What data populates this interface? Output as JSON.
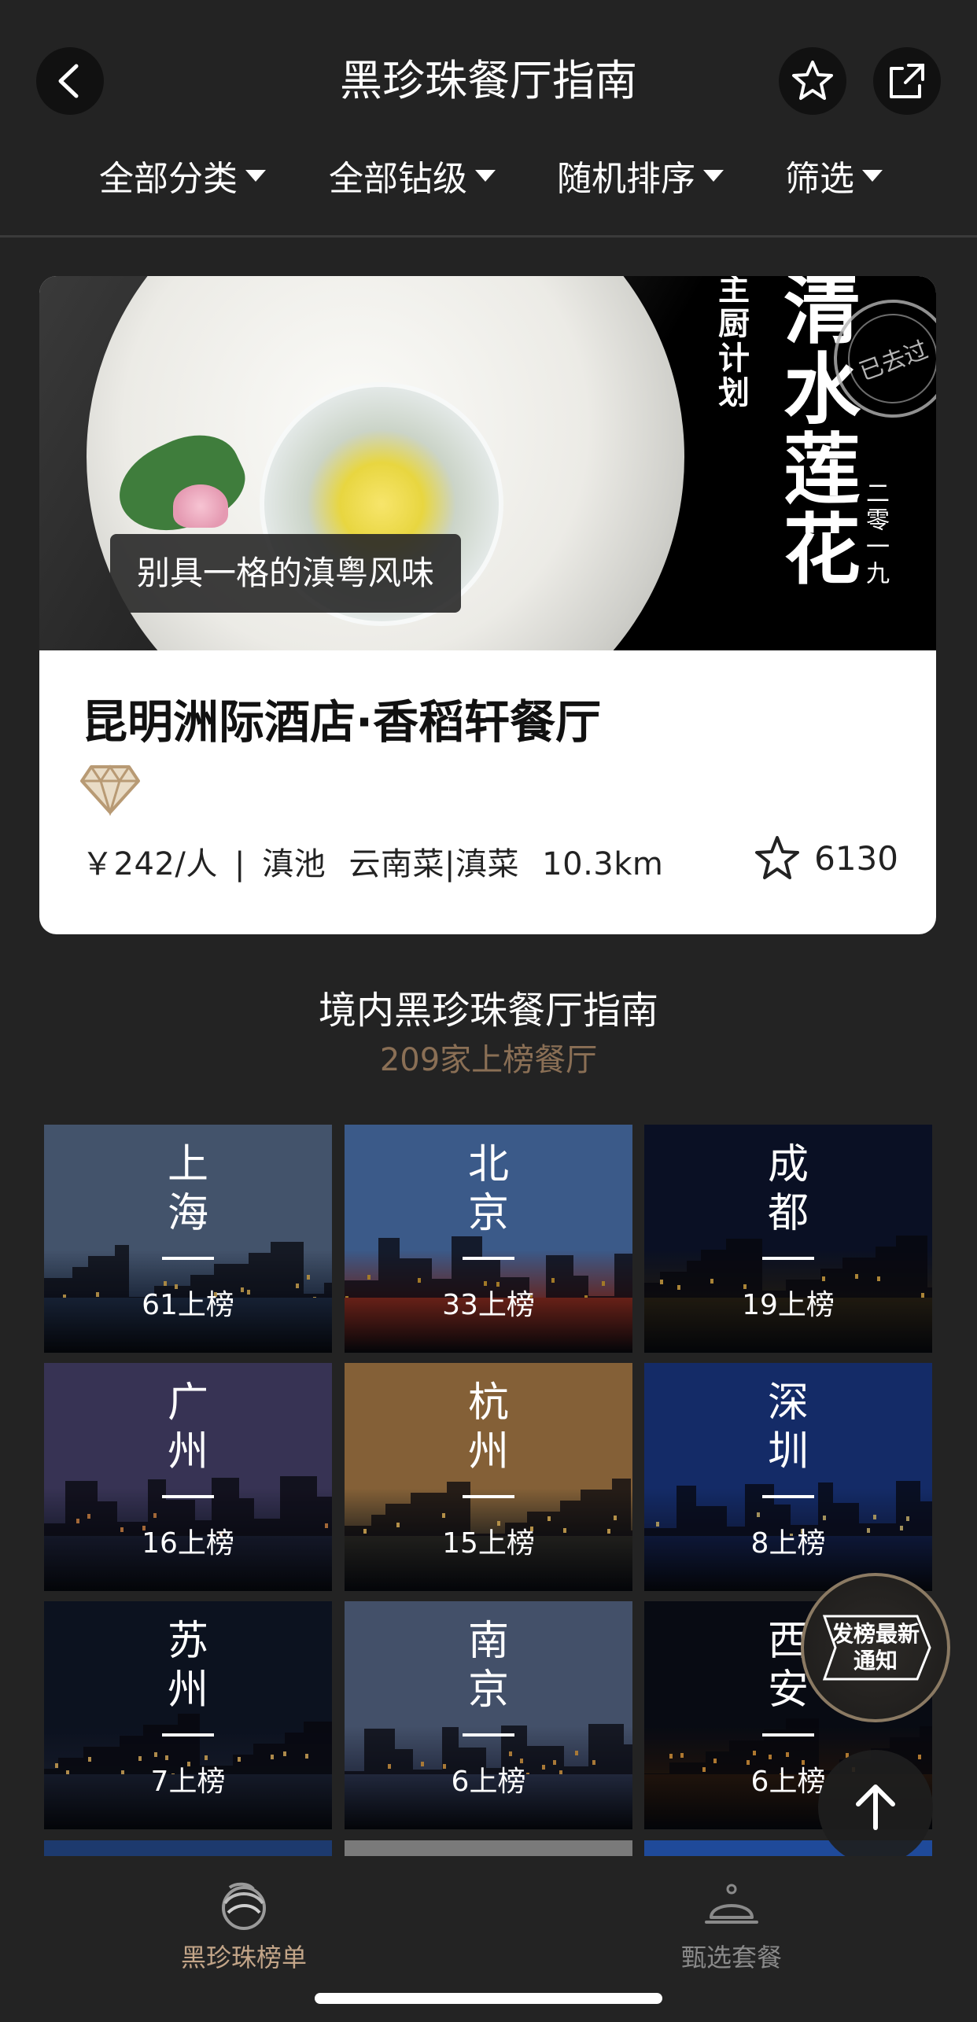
{
  "header": {
    "title": "黑珍珠餐厅指南",
    "back_icon": "chevron-left-icon",
    "favorite_icon": "star-icon",
    "share_icon": "share-icon"
  },
  "filters": [
    {
      "label": "全部分类"
    },
    {
      "label": "全部钻级"
    },
    {
      "label": "随机排序"
    },
    {
      "label": "筛选"
    }
  ],
  "featured": {
    "image_tag": "别具一格的滇粤风味",
    "image_calligraphy": {
      "main": "清水莲花",
      "side": "主厨计划",
      "year": "二零一九",
      "stamp": "已去过"
    },
    "name": "昆明洲际酒店·香稻轩餐厅",
    "diamond_icon": "diamond-icon",
    "price": "￥242/人",
    "separator": "|",
    "district": "滇池",
    "cuisine": "云南菜|滇菜",
    "distance": "10.3km",
    "favorites": "6130"
  },
  "section": {
    "title": "境内黑珍珠餐厅指南",
    "subtitle": "209家上榜餐厅"
  },
  "cities": [
    {
      "name1": "上",
      "name2": "海",
      "count": "61上榜",
      "sky": "#5a6f8f",
      "ground": "#1e2c45",
      "light": "#e0b55a"
    },
    {
      "name1": "北",
      "name2": "京",
      "count": "33上榜",
      "sky": "#4f78b7",
      "ground": "#8a2c20",
      "light": "#d8a235"
    },
    {
      "name1": "成",
      "name2": "都",
      "count": "19上榜",
      "sky": "#0e1630",
      "ground": "#2a2316",
      "light": "#e3b04a"
    },
    {
      "name1": "广",
      "name2": "州",
      "count": "16上榜",
      "sky": "#4a4470",
      "ground": "#1b2035",
      "light": "#d88a4a"
    },
    {
      "name1": "杭",
      "name2": "州",
      "count": "15上榜",
      "sky": "#b0814a",
      "ground": "#2b2a26",
      "light": "#f0c060"
    },
    {
      "name1": "深",
      "name2": "圳",
      "count": "8上榜",
      "sky": "#1b3a8a",
      "ground": "#13204a",
      "light": "#d9c07a"
    },
    {
      "name1": "苏",
      "name2": "州",
      "count": "7上榜",
      "sky": "#10182a",
      "ground": "#1c2336",
      "light": "#e9b864"
    },
    {
      "name1": "南",
      "name2": "京",
      "count": "6上榜",
      "sky": "#5a6b8c",
      "ground": "#2c3550",
      "light": "#e0a24a"
    },
    {
      "name1": "西",
      "name2": "安",
      "count": "6上榜",
      "sky": "#0b0f1a",
      "ground": "#2a1a10",
      "light": "#e8a040"
    }
  ],
  "floating": {
    "notify_line1": "发榜最新",
    "notify_line2": "通知",
    "top_icon": "arrow-up-icon"
  },
  "tabs": [
    {
      "label": "黑珍珠榜单",
      "icon": "pearl-icon",
      "active": true
    },
    {
      "label": "甄选套餐",
      "icon": "cloche-icon",
      "active": false
    }
  ]
}
